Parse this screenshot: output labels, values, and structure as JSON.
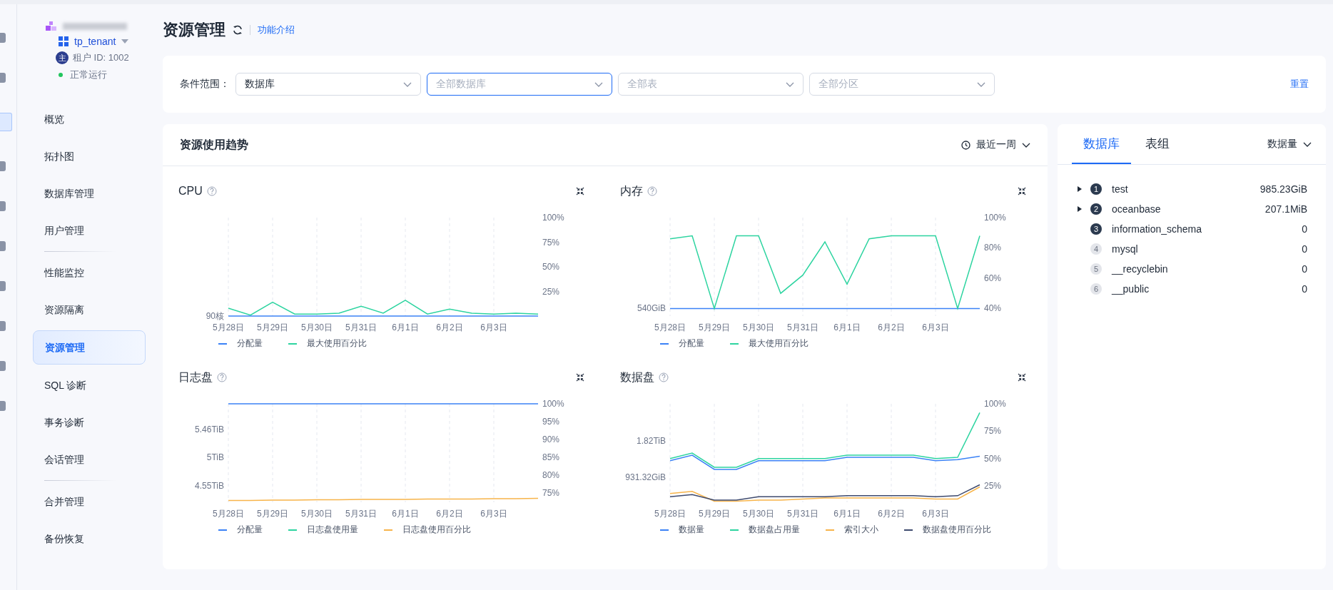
{
  "rail": [
    {
      "selected": false
    },
    {
      "selected": false
    },
    {
      "selected": true
    },
    {
      "selected": false
    },
    {
      "selected": false
    },
    {
      "selected": false
    },
    {
      "selected": false
    },
    {
      "selected": false
    },
    {
      "selected": false
    },
    {
      "selected": false
    }
  ],
  "tenant": {
    "name": "tp_tenant",
    "role_badge": "主",
    "id": "租户 ID: 1002",
    "status": "正常运行"
  },
  "nav": [
    {
      "label": "概览",
      "selected": false,
      "divider_after": false
    },
    {
      "label": "拓扑图",
      "selected": false,
      "divider_after": false
    },
    {
      "label": "数据库管理",
      "selected": false,
      "divider_after": false
    },
    {
      "label": "用户管理",
      "selected": false,
      "divider_after": true
    },
    {
      "label": "性能监控",
      "selected": false,
      "divider_after": false
    },
    {
      "label": "资源隔离",
      "selected": false,
      "divider_after": false
    },
    {
      "label": "资源管理",
      "selected": true,
      "divider_after": false
    },
    {
      "label": "SQL 诊断",
      "selected": false,
      "divider_after": false
    },
    {
      "label": "事务诊断",
      "selected": false,
      "divider_after": false
    },
    {
      "label": "会话管理",
      "selected": false,
      "divider_after": true
    },
    {
      "label": "合并管理",
      "selected": false,
      "divider_after": false
    },
    {
      "label": "备份恢复",
      "selected": false,
      "divider_after": false
    }
  ],
  "header": {
    "title": "资源管理",
    "link": "功能介绍"
  },
  "filter": {
    "label": "条件范围：",
    "selects": [
      {
        "value": "数据库",
        "focused": false
      },
      {
        "placeholder": "全部数据库",
        "focused": true
      },
      {
        "placeholder": "全部表",
        "focused": false
      },
      {
        "placeholder": "全部分区",
        "focused": false
      }
    ],
    "reset": "重置"
  },
  "trend": {
    "title": "资源使用趋势",
    "range": "最近一周",
    "charts": [
      {
        "chart_data": {
          "type": "line",
          "title": "CPU",
          "categories": [
            "5月28日",
            null,
            "5月29日",
            null,
            "5月30日",
            null,
            "5月31日",
            null,
            "6月1日",
            null,
            "6月2日",
            null,
            "6月3日",
            null,
            null
          ],
          "ylim": [
            0,
            100
          ],
          "yticks": [
            {
              "value": 25,
              "label": "25%"
            },
            {
              "value": 50,
              "label": "50%"
            },
            {
              "value": 75,
              "label": "75%"
            },
            {
              "value": 100,
              "label": "100%"
            }
          ],
          "annotations": [
            "90核"
          ],
          "grid": true,
          "series": [
            {
              "name": "分配量",
              "color": "#3b82f6",
              "values": [
                0,
                0,
                0,
                0,
                0,
                0,
                0,
                0,
                0,
                0,
                0,
                0,
                0,
                0,
                0
              ]
            },
            {
              "name": "最大使用百分比",
              "color": "#2dd4a0",
              "values": [
                8,
                1,
                14,
                2,
                2,
                3,
                10,
                3,
                16,
                2,
                7,
                3,
                2,
                3,
                2
              ]
            }
          ]
        }
      },
      {
        "chart_data": {
          "type": "line",
          "title": "内存",
          "categories": [
            "5月28日",
            null,
            "5月29日",
            null,
            "5月30日",
            null,
            "5月31日",
            null,
            "6月1日",
            null,
            "6月2日",
            null,
            "6月3日",
            null,
            null
          ],
          "ylim": [
            35,
            100
          ],
          "yticks": [
            {
              "value": 40,
              "label": "40%"
            },
            {
              "value": 60,
              "label": "60%"
            },
            {
              "value": 80,
              "label": "80%"
            },
            {
              "value": 100,
              "label": "100%"
            }
          ],
          "annotations": [
            "540GiB"
          ],
          "grid": true,
          "series": [
            {
              "name": "分配量",
              "color": "#3b82f6",
              "values": [
                40,
                40,
                40,
                40,
                40,
                40,
                40,
                40,
                40,
                40,
                40,
                40,
                40,
                40,
                40
              ]
            },
            {
              "name": "最大使用百分比",
              "color": "#2dd4a0",
              "values": [
                86,
                88,
                40,
                88,
                88,
                50,
                62,
                84,
                56,
                86,
                88,
                88,
                88,
                40,
                88
              ]
            }
          ]
        }
      },
      {
        "chart_data": {
          "type": "line",
          "title": "日志盘",
          "categories": [
            "5月28日",
            null,
            "5月29日",
            null,
            "5月30日",
            null,
            "5月31日",
            null,
            "6月1日",
            null,
            "6月2日",
            null,
            "6月3日",
            null,
            null
          ],
          "ylim": [
            72.5,
            100
          ],
          "yticks": [
            {
              "value": 75,
              "label": "75%"
            },
            {
              "value": 80,
              "label": "80%"
            },
            {
              "value": 85,
              "label": "85%"
            },
            {
              "value": 90,
              "label": "90%"
            },
            {
              "value": 95,
              "label": "95%"
            },
            {
              "value": 100,
              "label": "100%"
            }
          ],
          "annotations": [
            "4.55TiB",
            "5TiB",
            "5.46TiB"
          ],
          "grid": true,
          "series": [
            {
              "name": "分配量",
              "color": "#3b82f6",
              "values": [
                100,
                100,
                100,
                100,
                100,
                100,
                100,
                100,
                100,
                100,
                100,
                100,
                100,
                100,
                100
              ]
            },
            {
              "name": "日志盘使用量",
              "color": "#2dd4a0",
              "values": [
                null,
                null,
                null,
                null,
                null,
                null,
                null,
                null,
                null,
                null,
                null,
                null,
                null,
                null,
                null
              ]
            },
            {
              "name": "日志盘使用百分比",
              "color": "#f7b44a",
              "values": [
                73,
                73,
                73.1,
                73.1,
                73.2,
                73.2,
                73.3,
                73.3,
                73.3,
                73.4,
                73.4,
                73.4,
                73.5,
                73.5,
                73.6
              ]
            }
          ]
        }
      },
      {
        "chart_data": {
          "type": "line",
          "title": "数据盘",
          "categories": [
            "5月28日",
            null,
            "5月29日",
            null,
            "5月30日",
            null,
            "5月31日",
            null,
            "6月1日",
            null,
            "6月2日",
            null,
            "6月3日",
            null,
            null
          ],
          "ylim": [
            10,
            100
          ],
          "yticks": [
            {
              "value": 25,
              "label": "25%"
            },
            {
              "value": 50,
              "label": "50%"
            },
            {
              "value": 75,
              "label": "75%"
            },
            {
              "value": 100,
              "label": "100%"
            }
          ],
          "annotations": [
            "931.32GiB",
            "1.82TiB"
          ],
          "grid": true,
          "series": [
            {
              "name": "数据量",
              "color": "#3b82f6",
              "values": [
                48,
                53,
                40,
                40,
                48,
                48,
                48,
                48,
                51,
                51,
                51,
                51,
                48,
                49,
                52
              ]
            },
            {
              "name": "数据盘占用量",
              "color": "#2dd4a0",
              "values": [
                50,
                55,
                42,
                42,
                50,
                50,
                50,
                50,
                53,
                53,
                53,
                53,
                50,
                51,
                92
              ]
            },
            {
              "name": "索引大小",
              "color": "#f7b44a",
              "values": [
                18,
                20,
                11,
                11,
                12,
                12,
                13,
                14,
                14,
                14,
                14,
                14,
                13,
                13,
                24
              ]
            },
            {
              "name": "数据盘使用百分比",
              "color": "#3e4a6e",
              "values": [
                15,
                17,
                12,
                12,
                15,
                15,
                15,
                15,
                16,
                16,
                16,
                16,
                15,
                16,
                26
              ]
            }
          ]
        }
      }
    ]
  },
  "ranking": {
    "tabs": [
      {
        "label": "数据库",
        "selected": true
      },
      {
        "label": "表组",
        "selected": false
      }
    ],
    "sort": "数据量",
    "rows": [
      {
        "rank": "1",
        "name": "test",
        "value": "985.23GiB",
        "expandable": true,
        "top": true
      },
      {
        "rank": "2",
        "name": "oceanbase",
        "value": "207.1MiB",
        "expandable": true,
        "top": true
      },
      {
        "rank": "3",
        "name": "information_schema",
        "value": "0",
        "expandable": false,
        "top": true
      },
      {
        "rank": "4",
        "name": "mysql",
        "value": "0",
        "expandable": false,
        "top": false
      },
      {
        "rank": "5",
        "name": "__recyclebin",
        "value": "0",
        "expandable": false,
        "top": false
      },
      {
        "rank": "6",
        "name": "__public",
        "value": "0",
        "expandable": false,
        "top": false
      }
    ]
  }
}
